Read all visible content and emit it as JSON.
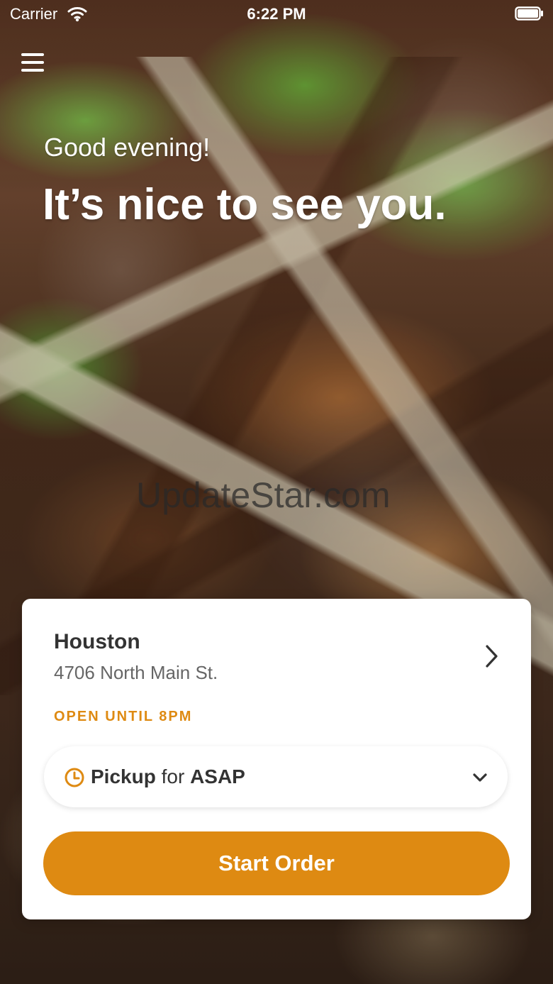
{
  "status_bar": {
    "carrier": "Carrier",
    "time": "6:22 PM",
    "wifi_icon": "wifi-icon",
    "battery_icon": "battery-icon"
  },
  "header": {
    "menu_icon": "hamburger-menu-icon"
  },
  "hero": {
    "greeting": "Good evening!",
    "headline": "It’s nice to see you."
  },
  "watermark": {
    "text": "UpdateStar.com"
  },
  "card": {
    "store_name": "Houston",
    "store_address": "4706 North Main St.",
    "store_hours": "OPEN UNTIL 8PM",
    "location_chevron_icon": "chevron-right-icon",
    "pickup": {
      "mode": "Pickup",
      "connector": "for",
      "time": "ASAP",
      "clock_icon": "clock-icon",
      "dropdown_icon": "chevron-down-icon"
    },
    "start_order_label": "Start Order"
  },
  "colors": {
    "accent": "#de8a12",
    "text_primary": "#333333",
    "text_secondary": "#666666",
    "card_background": "#ffffff",
    "overlay_text": "#ffffff"
  }
}
